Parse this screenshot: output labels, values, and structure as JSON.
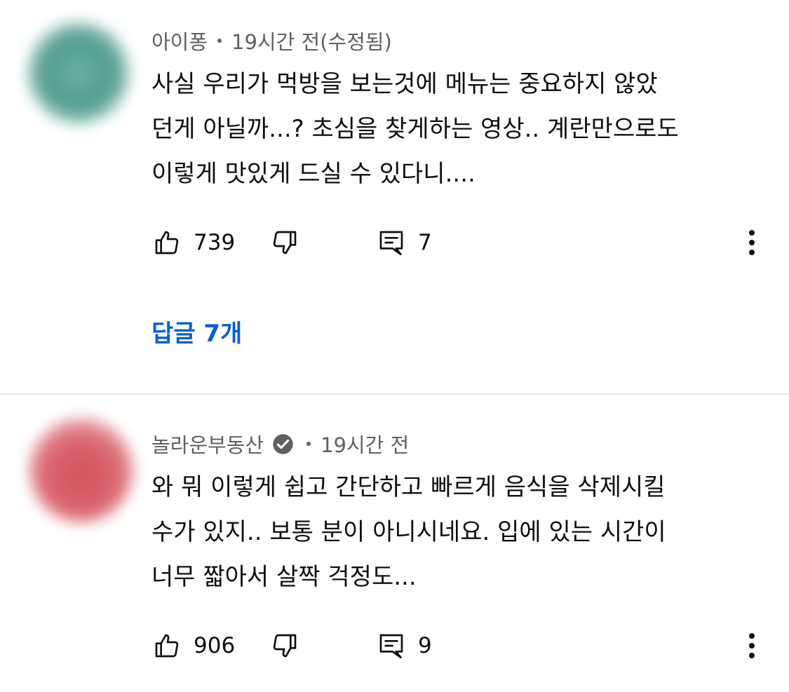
{
  "comments": [
    {
      "author": "아이퐁",
      "time": "19시간 전(수정됨)",
      "verified": false,
      "avatar_color": "#4f9a8e",
      "lines": [
        "사실 우리가 먹방을 보는것에 메뉴는 중요하지 않았",
        "던게 아닐까...? 초심을 찾게하는 영상.. 계란만으로도",
        "이렇게 맛있게 드실 수 있다니...."
      ],
      "likes": "739",
      "replies": "7",
      "replies_link": "답글 7개"
    },
    {
      "author": "놀라운부동산",
      "time": "19시간 전",
      "verified": true,
      "avatar_color": "#d9646e",
      "lines": [
        "와 뭐 이렇게 쉽고 간단하고 빠르게 음식을 삭제시킬",
        "수가 있지.. 보통 분이 아니시네요. 입에 있는 시간이",
        "너무 짧아서 살짝 걱정도..."
      ],
      "likes": "906",
      "replies": "9"
    }
  ],
  "icons": {
    "like": "thumbs-up-icon",
    "dislike": "thumbs-down-icon",
    "reply": "comment-icon",
    "more": "more-vert-icon",
    "verified": "verified-check-icon"
  },
  "colors": {
    "link": "#065fd4",
    "meta": "#606060",
    "text": "#0f0f0f"
  }
}
